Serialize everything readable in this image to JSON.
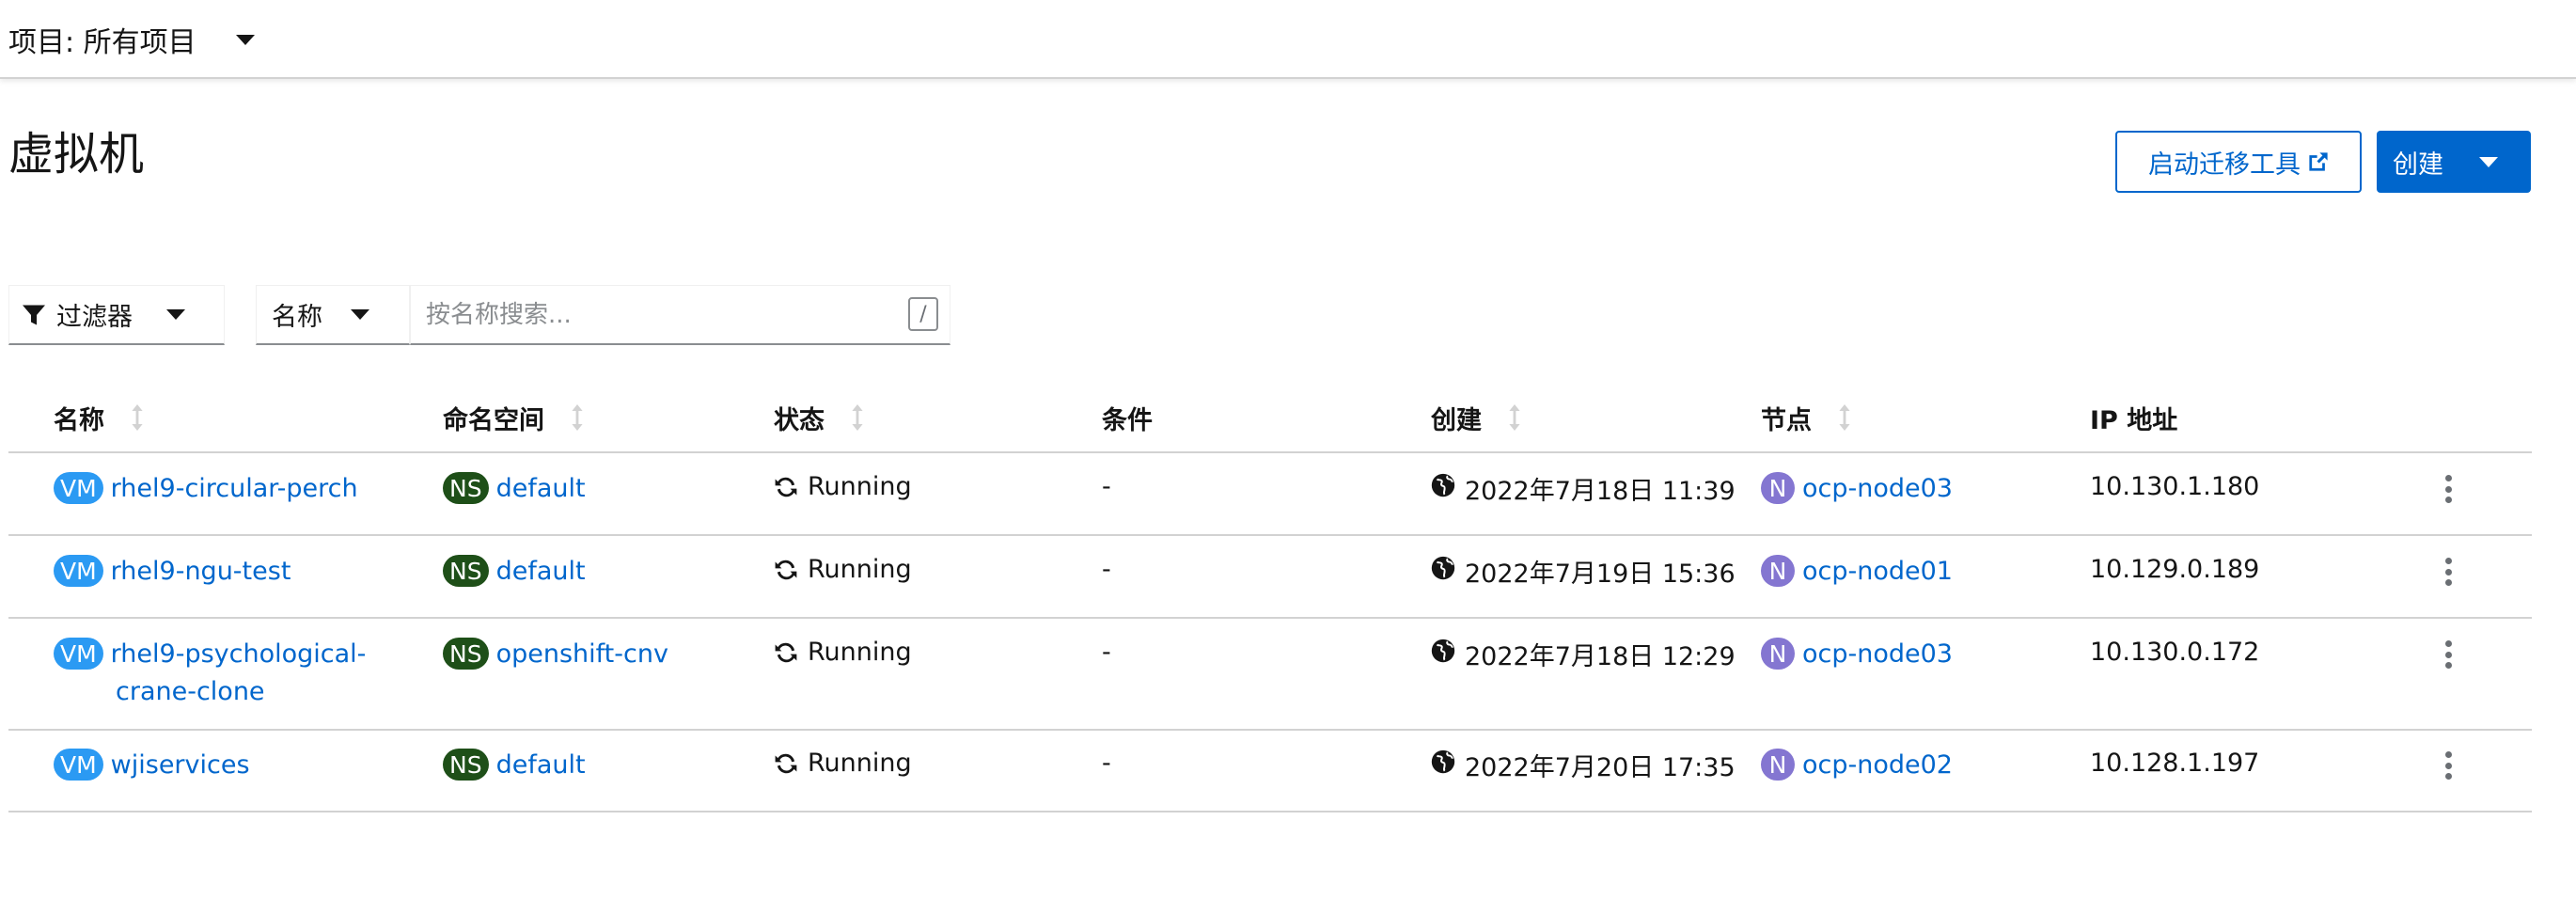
{
  "project": {
    "label": "项目: 所有项目"
  },
  "page": {
    "title": "虚拟机",
    "migrate_button": "启动迁移工具",
    "create_button": "创建"
  },
  "toolbar": {
    "filter_label": "过滤器",
    "name_dropdown": "名称",
    "search_placeholder": "按名称搜索...",
    "shortcut_key": "/"
  },
  "table": {
    "headers": {
      "name": "名称",
      "namespace": "命名空间",
      "status": "状态",
      "conditions": "条件",
      "created": "创建",
      "node": "节点",
      "ip": "IP 地址"
    },
    "badges": {
      "vm": "VM",
      "ns": "NS",
      "node": "N"
    },
    "rows": [
      {
        "name": "rhel9-circular-perch",
        "name2": "",
        "namespace": "default",
        "status": "Running",
        "conditions": "-",
        "created": "2022年7月18日 11:39",
        "node": "ocp-node03",
        "ip": "10.130.1.180"
      },
      {
        "name": "rhel9-ngu-test",
        "name2": "",
        "namespace": "default",
        "status": "Running",
        "conditions": "-",
        "created": "2022年7月19日 15:36",
        "node": "ocp-node01",
        "ip": "10.129.0.189"
      },
      {
        "name": "rhel9-psychological-",
        "name2": "crane-clone",
        "namespace": "openshift-cnv",
        "status": "Running",
        "conditions": "-",
        "created": "2022年7月18日 12:29",
        "node": "ocp-node03",
        "ip": "10.130.0.172"
      },
      {
        "name": "wjiservices",
        "name2": "",
        "namespace": "default",
        "status": "Running",
        "conditions": "-",
        "created": "2022年7月20日 17:35",
        "node": "ocp-node02",
        "ip": "10.128.1.197"
      }
    ]
  },
  "colors": {
    "link": "#0066cc",
    "vm_badge": "#2b9af3",
    "ns_badge": "#1e4f18",
    "node_badge": "#8476d1"
  }
}
